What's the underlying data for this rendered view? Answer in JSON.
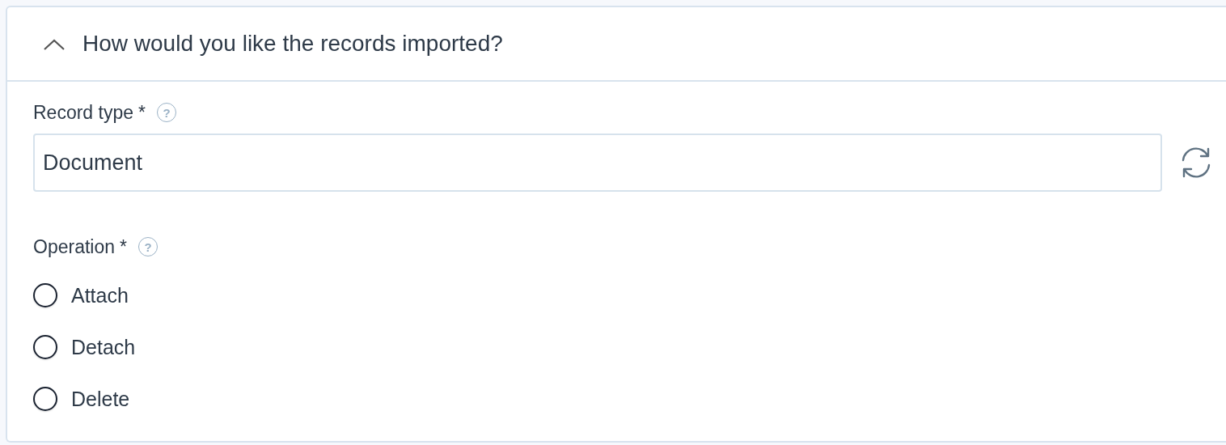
{
  "section": {
    "title": "How would you like the records imported?",
    "expanded": true
  },
  "record_type": {
    "label": "Record type",
    "required_mark": "*",
    "help": "?",
    "value": "Document"
  },
  "operation": {
    "label": "Operation",
    "required_mark": "*",
    "help": "?",
    "options": [
      {
        "label": "Attach",
        "selected": false
      },
      {
        "label": "Detach",
        "selected": false
      },
      {
        "label": "Delete",
        "selected": false
      }
    ]
  }
}
